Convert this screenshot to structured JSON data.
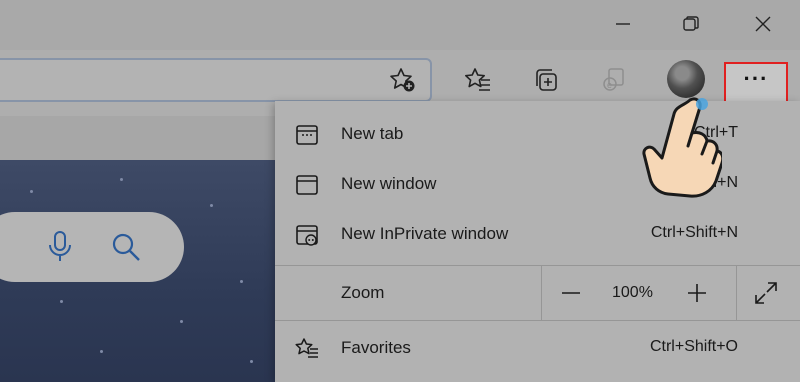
{
  "window": {
    "controls": [
      "minimize-icon",
      "restore-icon",
      "close-icon"
    ]
  },
  "toolbar": {
    "address_icon": "add-favorite-icon",
    "icons": [
      "favorites-icon",
      "collections-icon",
      "internet-explorer-icon",
      "profile-avatar"
    ],
    "more_label": "···"
  },
  "menu": {
    "items": [
      {
        "icon": "new-tab-icon",
        "label": "New tab",
        "shortcut": "Ctrl+T"
      },
      {
        "icon": "new-window-icon",
        "label": "New window",
        "shortcut": "Ctrl+N"
      },
      {
        "icon": "inprivate-icon",
        "label": "New InPrivate window",
        "shortcut": "Ctrl+Shift+N"
      }
    ],
    "zoom": {
      "label": "Zoom",
      "value": "100%",
      "minus": "−",
      "plus": "+"
    },
    "favorites": {
      "icon": "favorites-icon",
      "label": "Favorites",
      "shortcut": "Ctrl+Shift+O"
    }
  },
  "colors": {
    "highlight_border": "#e02020",
    "backdrop": "#a9a9a9",
    "hero": "#2f3b57"
  }
}
